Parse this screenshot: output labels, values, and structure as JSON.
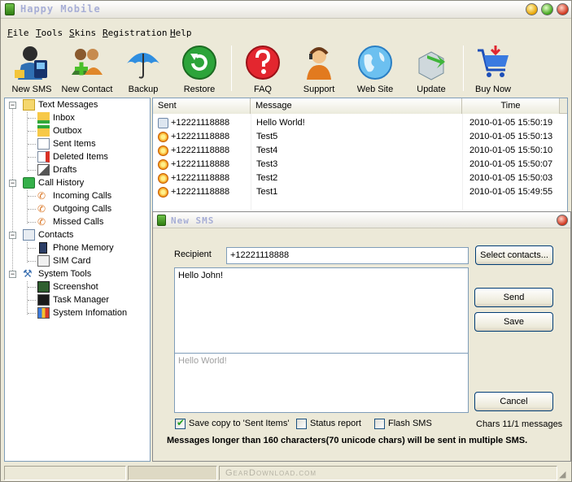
{
  "app": {
    "title": "Happy Mobile"
  },
  "menu": [
    "File",
    "Tools",
    "Skins",
    "Registration",
    "Help"
  ],
  "toolbar": [
    {
      "label": "New SMS",
      "icon": "new-sms-icon"
    },
    {
      "label": "New Contact",
      "icon": "new-contact-icon"
    },
    {
      "label": "Backup",
      "icon": "umbrella-icon"
    },
    {
      "label": "Restore",
      "icon": "restore-icon"
    },
    {
      "label": "FAQ",
      "icon": "question-icon"
    },
    {
      "label": "Support",
      "icon": "headset-icon"
    },
    {
      "label": "Web Site",
      "icon": "globe-icon"
    },
    {
      "label": "Update",
      "icon": "update-icon"
    },
    {
      "label": "Buy Now",
      "icon": "cart-icon"
    }
  ],
  "tree": [
    {
      "label": "Text Messages",
      "level": 0,
      "icon": "folder-icon",
      "expanded": true
    },
    {
      "label": "Inbox",
      "level": 1,
      "icon": "inbox-icon"
    },
    {
      "label": "Outbox",
      "level": 1,
      "icon": "outbox-icon"
    },
    {
      "label": "Sent Items",
      "level": 1,
      "icon": "sent-items-icon"
    },
    {
      "label": "Deleted Items",
      "level": 1,
      "icon": "deleted-items-icon"
    },
    {
      "label": "Drafts",
      "level": 1,
      "icon": "drafts-icon"
    },
    {
      "label": "Call History",
      "level": 0,
      "icon": "call-history-icon",
      "expanded": true
    },
    {
      "label": "Incoming Calls",
      "level": 1,
      "icon": "incoming-call-icon"
    },
    {
      "label": "Outgoing Calls",
      "level": 1,
      "icon": "outgoing-call-icon"
    },
    {
      "label": "Missed Calls",
      "level": 1,
      "icon": "missed-call-icon"
    },
    {
      "label": "Contacts",
      "level": 0,
      "icon": "contacts-icon",
      "expanded": true
    },
    {
      "label": "Phone Memory",
      "level": 1,
      "icon": "phone-memory-icon"
    },
    {
      "label": "SIM Card",
      "level": 1,
      "icon": "sim-card-icon"
    },
    {
      "label": "System Tools",
      "level": 0,
      "icon": "system-tools-icon",
      "expanded": true
    },
    {
      "label": "Screenshot",
      "level": 1,
      "icon": "screenshot-icon"
    },
    {
      "label": "Task Manager",
      "level": 1,
      "icon": "task-manager-icon"
    },
    {
      "label": "System Infomation",
      "level": 1,
      "icon": "system-info-icon"
    }
  ],
  "list": {
    "columns": [
      "Sent",
      "Message",
      "Time"
    ],
    "rows": [
      {
        "sent": "+12221118888",
        "message": "Hello World!",
        "time": "2010-01-05 15:50:19",
        "status": "read"
      },
      {
        "sent": "+12221118888",
        "message": "Test5",
        "time": "2010-01-05 15:50:13",
        "status": "unread"
      },
      {
        "sent": "+12221118888",
        "message": "Test4",
        "time": "2010-01-05 15:50:10",
        "status": "unread"
      },
      {
        "sent": "+12221118888",
        "message": "Test3",
        "time": "2010-01-05 15:50:07",
        "status": "unread"
      },
      {
        "sent": "+12221118888",
        "message": "Test2",
        "time": "2010-01-05 15:50:03",
        "status": "unread"
      },
      {
        "sent": "+12221118888",
        "message": "Test1",
        "time": "2010-01-05 15:49:55",
        "status": "unread"
      }
    ]
  },
  "dialog": {
    "title": "New SMS",
    "recipient_label": "Recipient",
    "recipient_value": "+12221118888",
    "select_contacts": "Select contacts...",
    "message_text": "Hello John!",
    "preview_text": "Hello World!",
    "send": "Send",
    "save": "Save",
    "cancel": "Cancel",
    "save_copy": "Save copy to 'Sent Items'",
    "save_copy_checked": true,
    "status_report": "Status report",
    "status_report_checked": false,
    "flash_sms": "Flash SMS",
    "flash_sms_checked": false,
    "chars_info": "Chars 11/1 messages",
    "notice": "Messages longer than 160 characters(70 unicode chars) will be sent in multiple SMS."
  },
  "watermark": "GearDownload.com"
}
